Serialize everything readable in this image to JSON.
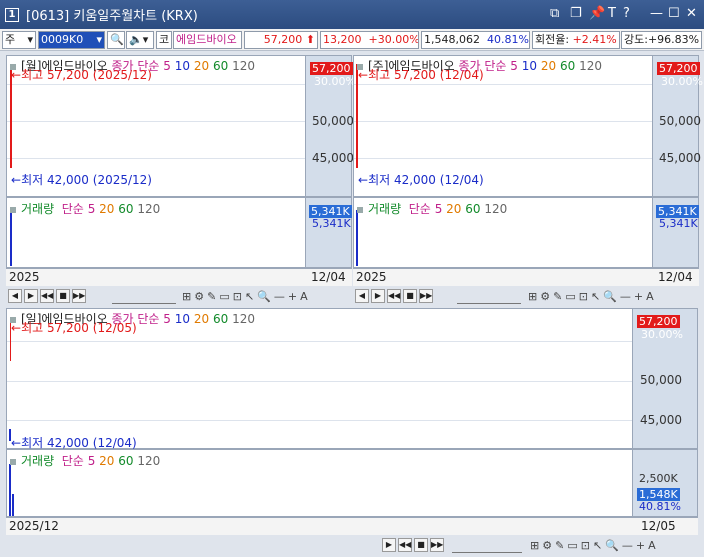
{
  "window": {
    "num": "1",
    "title": "[0613] 키움일주월차트 (KRX)"
  },
  "toolbar": {
    "period": "주",
    "code": "0009K0",
    "market": "코",
    "name": "에임드바이오",
    "price": "57,200",
    "change": "13,200",
    "change_pct": "+30.00%",
    "volume": "1,548,062",
    "vol_ratio": "40.81%",
    "turnover_label": "회전율:",
    "turnover": "+2.41%",
    "strength_label": "강도:",
    "strength": "+96.83%"
  },
  "monthly": {
    "header": "[월]에임드바이오",
    "ma_label": "종가 단순",
    "ma": [
      "5",
      "10",
      "20",
      "60",
      "120"
    ],
    "high": "최고 57,200 (2025/12)",
    "low": "최저 42,000 (2025/12)",
    "ticks": [
      "50,000",
      "45,000"
    ],
    "price_badge": "57,200",
    "pct_badge": "30.00%",
    "vol_label": "거래량",
    "vol_ma_label": "단순",
    "vol_ma": [
      "5",
      "20",
      "60",
      "120"
    ],
    "vol_badge": "5,341K",
    "vol_tick": "5,341K",
    "footer_left": "2025",
    "footer_right": "12/04"
  },
  "weekly": {
    "header": "[주]에임드바이오",
    "ma_label": "종가 단순",
    "ma": [
      "5",
      "10",
      "20",
      "60",
      "120"
    ],
    "high": "최고 57,200 (12/04)",
    "low": "최저 42,000 (12/04)",
    "ticks": [
      "50,000",
      "45,000"
    ],
    "price_badge": "57,200",
    "pct_badge": "30.00%",
    "vol_label": "거래량",
    "vol_ma_label": "단순",
    "vol_ma": [
      "5",
      "20",
      "60",
      "120"
    ],
    "vol_badge": "5,341K",
    "vol_tick": "5,341K",
    "footer_left": "2025",
    "footer_right": "12/04"
  },
  "daily": {
    "header": "[일]에임드바이오",
    "ma_label": "종가 단순",
    "ma": [
      "5",
      "10",
      "20",
      "60",
      "120"
    ],
    "high": "최고 57,200 (12/05)",
    "low": "최저 42,000 (12/04)",
    "ticks": [
      "50,000",
      "45,000"
    ],
    "price_badge": "57,200",
    "pct_badge": "30.00%",
    "vol_label": "거래량",
    "vol_ma_label": "단순",
    "vol_ma": [
      "5",
      "20",
      "60",
      "120"
    ],
    "vol_tick": "2,500K",
    "vol_badge": "1,548K",
    "vol_pct": "40.81%",
    "footer_left": "2025/12",
    "footer_right": "12/05"
  },
  "colors": {
    "up": "#e21a1a",
    "down": "#1a2cc8",
    "axis_bg": "#d3ddea"
  }
}
